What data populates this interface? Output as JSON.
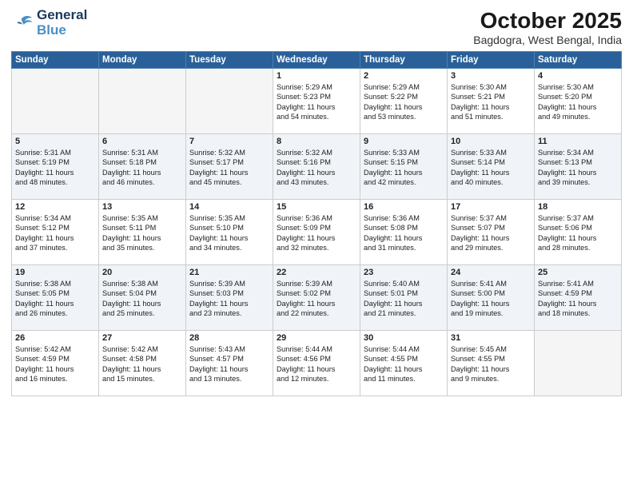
{
  "header": {
    "logo_line1": "General",
    "logo_line2": "Blue",
    "month": "October 2025",
    "location": "Bagdogra, West Bengal, India"
  },
  "weekdays": [
    "Sunday",
    "Monday",
    "Tuesday",
    "Wednesday",
    "Thursday",
    "Friday",
    "Saturday"
  ],
  "weeks": [
    [
      {
        "day": "",
        "text": ""
      },
      {
        "day": "",
        "text": ""
      },
      {
        "day": "",
        "text": ""
      },
      {
        "day": "1",
        "text": "Sunrise: 5:29 AM\nSunset: 5:23 PM\nDaylight: 11 hours\nand 54 minutes."
      },
      {
        "day": "2",
        "text": "Sunrise: 5:29 AM\nSunset: 5:22 PM\nDaylight: 11 hours\nand 53 minutes."
      },
      {
        "day": "3",
        "text": "Sunrise: 5:30 AM\nSunset: 5:21 PM\nDaylight: 11 hours\nand 51 minutes."
      },
      {
        "day": "4",
        "text": "Sunrise: 5:30 AM\nSunset: 5:20 PM\nDaylight: 11 hours\nand 49 minutes."
      }
    ],
    [
      {
        "day": "5",
        "text": "Sunrise: 5:31 AM\nSunset: 5:19 PM\nDaylight: 11 hours\nand 48 minutes."
      },
      {
        "day": "6",
        "text": "Sunrise: 5:31 AM\nSunset: 5:18 PM\nDaylight: 11 hours\nand 46 minutes."
      },
      {
        "day": "7",
        "text": "Sunrise: 5:32 AM\nSunset: 5:17 PM\nDaylight: 11 hours\nand 45 minutes."
      },
      {
        "day": "8",
        "text": "Sunrise: 5:32 AM\nSunset: 5:16 PM\nDaylight: 11 hours\nand 43 minutes."
      },
      {
        "day": "9",
        "text": "Sunrise: 5:33 AM\nSunset: 5:15 PM\nDaylight: 11 hours\nand 42 minutes."
      },
      {
        "day": "10",
        "text": "Sunrise: 5:33 AM\nSunset: 5:14 PM\nDaylight: 11 hours\nand 40 minutes."
      },
      {
        "day": "11",
        "text": "Sunrise: 5:34 AM\nSunset: 5:13 PM\nDaylight: 11 hours\nand 39 minutes."
      }
    ],
    [
      {
        "day": "12",
        "text": "Sunrise: 5:34 AM\nSunset: 5:12 PM\nDaylight: 11 hours\nand 37 minutes."
      },
      {
        "day": "13",
        "text": "Sunrise: 5:35 AM\nSunset: 5:11 PM\nDaylight: 11 hours\nand 35 minutes."
      },
      {
        "day": "14",
        "text": "Sunrise: 5:35 AM\nSunset: 5:10 PM\nDaylight: 11 hours\nand 34 minutes."
      },
      {
        "day": "15",
        "text": "Sunrise: 5:36 AM\nSunset: 5:09 PM\nDaylight: 11 hours\nand 32 minutes."
      },
      {
        "day": "16",
        "text": "Sunrise: 5:36 AM\nSunset: 5:08 PM\nDaylight: 11 hours\nand 31 minutes."
      },
      {
        "day": "17",
        "text": "Sunrise: 5:37 AM\nSunset: 5:07 PM\nDaylight: 11 hours\nand 29 minutes."
      },
      {
        "day": "18",
        "text": "Sunrise: 5:37 AM\nSunset: 5:06 PM\nDaylight: 11 hours\nand 28 minutes."
      }
    ],
    [
      {
        "day": "19",
        "text": "Sunrise: 5:38 AM\nSunset: 5:05 PM\nDaylight: 11 hours\nand 26 minutes."
      },
      {
        "day": "20",
        "text": "Sunrise: 5:38 AM\nSunset: 5:04 PM\nDaylight: 11 hours\nand 25 minutes."
      },
      {
        "day": "21",
        "text": "Sunrise: 5:39 AM\nSunset: 5:03 PM\nDaylight: 11 hours\nand 23 minutes."
      },
      {
        "day": "22",
        "text": "Sunrise: 5:39 AM\nSunset: 5:02 PM\nDaylight: 11 hours\nand 22 minutes."
      },
      {
        "day": "23",
        "text": "Sunrise: 5:40 AM\nSunset: 5:01 PM\nDaylight: 11 hours\nand 21 minutes."
      },
      {
        "day": "24",
        "text": "Sunrise: 5:41 AM\nSunset: 5:00 PM\nDaylight: 11 hours\nand 19 minutes."
      },
      {
        "day": "25",
        "text": "Sunrise: 5:41 AM\nSunset: 4:59 PM\nDaylight: 11 hours\nand 18 minutes."
      }
    ],
    [
      {
        "day": "26",
        "text": "Sunrise: 5:42 AM\nSunset: 4:59 PM\nDaylight: 11 hours\nand 16 minutes."
      },
      {
        "day": "27",
        "text": "Sunrise: 5:42 AM\nSunset: 4:58 PM\nDaylight: 11 hours\nand 15 minutes."
      },
      {
        "day": "28",
        "text": "Sunrise: 5:43 AM\nSunset: 4:57 PM\nDaylight: 11 hours\nand 13 minutes."
      },
      {
        "day": "29",
        "text": "Sunrise: 5:44 AM\nSunset: 4:56 PM\nDaylight: 11 hours\nand 12 minutes."
      },
      {
        "day": "30",
        "text": "Sunrise: 5:44 AM\nSunset: 4:55 PM\nDaylight: 11 hours\nand 11 minutes."
      },
      {
        "day": "31",
        "text": "Sunrise: 5:45 AM\nSunset: 4:55 PM\nDaylight: 11 hours\nand 9 minutes."
      },
      {
        "day": "",
        "text": ""
      }
    ]
  ]
}
